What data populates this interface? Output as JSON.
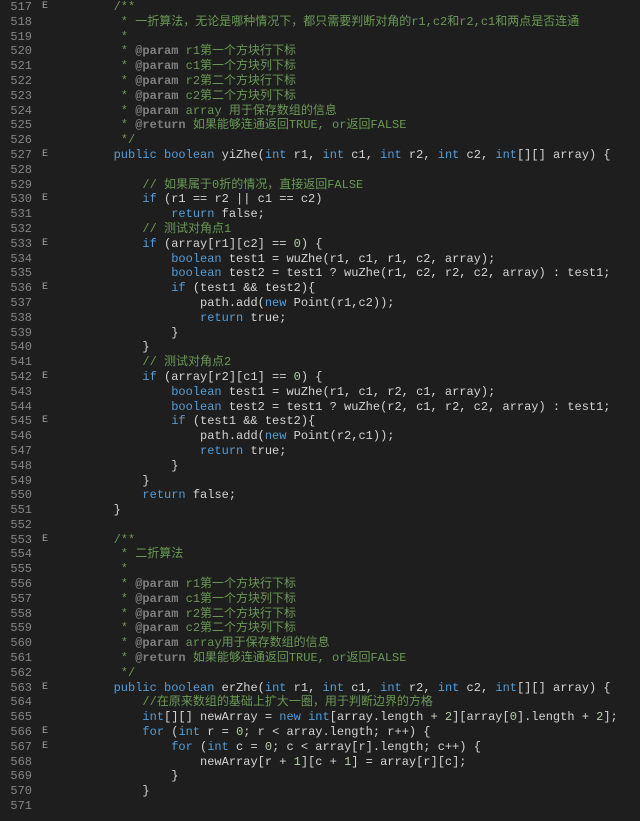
{
  "lines": [
    {
      "n": 517,
      "f": "E",
      "i": 2,
      "seg": [
        [
          "cmt",
          "/**"
        ]
      ]
    },
    {
      "n": 518,
      "f": "",
      "i": 2,
      "seg": [
        [
          "cmt",
          " * 一折算法，无论是哪种情况下，都只需要判断对角的r1,c2和r2,c1和两点是否连通"
        ]
      ]
    },
    {
      "n": 519,
      "f": "",
      "i": 2,
      "seg": [
        [
          "cmt",
          " *"
        ]
      ]
    },
    {
      "n": 520,
      "f": "",
      "i": 2,
      "seg": [
        [
          "cmt",
          " * "
        ],
        [
          "tag",
          "@param"
        ],
        [
          "cmt",
          " r1第一个方块行下标"
        ]
      ]
    },
    {
      "n": 521,
      "f": "",
      "i": 2,
      "seg": [
        [
          "cmt",
          " * "
        ],
        [
          "tag",
          "@param"
        ],
        [
          "cmt",
          " c1第一个方块列下标"
        ]
      ]
    },
    {
      "n": 522,
      "f": "",
      "i": 2,
      "seg": [
        [
          "cmt",
          " * "
        ],
        [
          "tag",
          "@param"
        ],
        [
          "cmt",
          " r2第二个方块行下标"
        ]
      ]
    },
    {
      "n": 523,
      "f": "",
      "i": 2,
      "seg": [
        [
          "cmt",
          " * "
        ],
        [
          "tag",
          "@param"
        ],
        [
          "cmt",
          " c2第二个方块列下标"
        ]
      ]
    },
    {
      "n": 524,
      "f": "",
      "i": 2,
      "seg": [
        [
          "cmt",
          " * "
        ],
        [
          "tag",
          "@param"
        ],
        [
          "cmt",
          " array 用于保存数组的信息"
        ]
      ]
    },
    {
      "n": 525,
      "f": "",
      "i": 2,
      "seg": [
        [
          "cmt",
          " * "
        ],
        [
          "tag",
          "@return"
        ],
        [
          "cmt",
          " 如果能够连通返回TRUE, or返回FALSE"
        ]
      ]
    },
    {
      "n": 526,
      "f": "",
      "i": 2,
      "seg": [
        [
          "cmt",
          " */"
        ]
      ]
    },
    {
      "n": 527,
      "f": "E",
      "i": 2,
      "seg": [
        [
          "kw",
          "public"
        ],
        [
          "pl",
          " "
        ],
        [
          "type",
          "boolean"
        ],
        [
          "pl",
          " "
        ],
        [
          "fn",
          "yiZhe"
        ],
        [
          "pl",
          "("
        ],
        [
          "type",
          "int"
        ],
        [
          "pl",
          " r1, "
        ],
        [
          "type",
          "int"
        ],
        [
          "pl",
          " c1, "
        ],
        [
          "type",
          "int"
        ],
        [
          "pl",
          " r2, "
        ],
        [
          "type",
          "int"
        ],
        [
          "pl",
          " c2, "
        ],
        [
          "type",
          "int"
        ],
        [
          "pl",
          "[][] array) {"
        ]
      ]
    },
    {
      "n": 528,
      "f": "",
      "i": 0,
      "seg": [
        [
          "pl",
          ""
        ]
      ]
    },
    {
      "n": 529,
      "f": "",
      "i": 3,
      "seg": [
        [
          "cmt",
          "// 如果属于0折的情况，直接返回FALSE"
        ]
      ]
    },
    {
      "n": 530,
      "f": "E",
      "i": 3,
      "seg": [
        [
          "kw",
          "if"
        ],
        [
          "pl",
          " (r1 == r2 || c1 == c2)"
        ]
      ]
    },
    {
      "n": 531,
      "f": "",
      "i": 4,
      "seg": [
        [
          "kw",
          "return"
        ],
        [
          "pl",
          " false;"
        ]
      ]
    },
    {
      "n": 532,
      "f": "",
      "i": 3,
      "seg": [
        [
          "cmt",
          "// 测试对角点1"
        ]
      ]
    },
    {
      "n": 533,
      "f": "E",
      "i": 3,
      "seg": [
        [
          "kw",
          "if"
        ],
        [
          "pl",
          " (array[r1][c2] == "
        ],
        [
          "num",
          "0"
        ],
        [
          "pl",
          ") {"
        ]
      ]
    },
    {
      "n": 534,
      "f": "",
      "i": 4,
      "seg": [
        [
          "type",
          "boolean"
        ],
        [
          "pl",
          " test1 = wuZhe(r1, c1, r1, c2, array);"
        ]
      ]
    },
    {
      "n": 535,
      "f": "",
      "i": 4,
      "seg": [
        [
          "type",
          "boolean"
        ],
        [
          "pl",
          " test2 = test1 ? wuZhe(r1, c2, r2, c2, array) : test1;"
        ]
      ]
    },
    {
      "n": 536,
      "f": "E",
      "i": 4,
      "seg": [
        [
          "kw",
          "if"
        ],
        [
          "pl",
          " (test1 && test2){"
        ]
      ]
    },
    {
      "n": 537,
      "f": "",
      "i": 5,
      "seg": [
        [
          "pl",
          "path.add("
        ],
        [
          "kw",
          "new"
        ],
        [
          "pl",
          " Point(r1,c2));"
        ]
      ]
    },
    {
      "n": 538,
      "f": "",
      "i": 5,
      "seg": [
        [
          "kw",
          "return"
        ],
        [
          "pl",
          " true;"
        ]
      ]
    },
    {
      "n": 539,
      "f": "",
      "i": 4,
      "seg": [
        [
          "pl",
          "}"
        ]
      ]
    },
    {
      "n": 540,
      "f": "",
      "i": 3,
      "seg": [
        [
          "pl",
          "}"
        ]
      ]
    },
    {
      "n": 541,
      "f": "",
      "i": 3,
      "seg": [
        [
          "cmt",
          "// 测试对角点2"
        ]
      ]
    },
    {
      "n": 542,
      "f": "E",
      "i": 3,
      "seg": [
        [
          "kw",
          "if"
        ],
        [
          "pl",
          " (array[r2][c1] == "
        ],
        [
          "num",
          "0"
        ],
        [
          "pl",
          ") {"
        ]
      ]
    },
    {
      "n": 543,
      "f": "",
      "i": 4,
      "seg": [
        [
          "type",
          "boolean"
        ],
        [
          "pl",
          " test1 = wuZhe(r1, c1, r2, c1, array);"
        ]
      ]
    },
    {
      "n": 544,
      "f": "",
      "i": 4,
      "seg": [
        [
          "type",
          "boolean"
        ],
        [
          "pl",
          " test2 = test1 ? wuZhe(r2, c1, r2, c2, array) : test1;"
        ]
      ]
    },
    {
      "n": 545,
      "f": "E",
      "i": 4,
      "seg": [
        [
          "kw",
          "if"
        ],
        [
          "pl",
          " (test1 && test2){"
        ]
      ]
    },
    {
      "n": 546,
      "f": "",
      "i": 5,
      "seg": [
        [
          "pl",
          "path.add("
        ],
        [
          "kw",
          "new"
        ],
        [
          "pl",
          " Point(r2,c1));"
        ]
      ]
    },
    {
      "n": 547,
      "f": "",
      "i": 5,
      "seg": [
        [
          "kw",
          "return"
        ],
        [
          "pl",
          " true;"
        ]
      ]
    },
    {
      "n": 548,
      "f": "",
      "i": 4,
      "seg": [
        [
          "pl",
          "}"
        ]
      ]
    },
    {
      "n": 549,
      "f": "",
      "i": 3,
      "seg": [
        [
          "pl",
          "}"
        ]
      ]
    },
    {
      "n": 550,
      "f": "",
      "i": 3,
      "seg": [
        [
          "kw",
          "return"
        ],
        [
          "pl",
          " false;"
        ]
      ]
    },
    {
      "n": 551,
      "f": "",
      "i": 2,
      "seg": [
        [
          "pl",
          "}"
        ]
      ]
    },
    {
      "n": 552,
      "f": "",
      "i": 0,
      "seg": [
        [
          "pl",
          ""
        ]
      ]
    },
    {
      "n": 553,
      "f": "E",
      "i": 2,
      "seg": [
        [
          "cmt",
          "/**"
        ]
      ]
    },
    {
      "n": 554,
      "f": "",
      "i": 2,
      "seg": [
        [
          "cmt",
          " * 二折算法"
        ]
      ]
    },
    {
      "n": 555,
      "f": "",
      "i": 2,
      "seg": [
        [
          "cmt",
          " *"
        ]
      ]
    },
    {
      "n": 556,
      "f": "",
      "i": 2,
      "seg": [
        [
          "cmt",
          " * "
        ],
        [
          "tag",
          "@param"
        ],
        [
          "cmt",
          " r1第一个方块行下标"
        ]
      ]
    },
    {
      "n": 557,
      "f": "",
      "i": 2,
      "seg": [
        [
          "cmt",
          " * "
        ],
        [
          "tag",
          "@param"
        ],
        [
          "cmt",
          " c1第一个方块列下标"
        ]
      ]
    },
    {
      "n": 558,
      "f": "",
      "i": 2,
      "seg": [
        [
          "cmt",
          " * "
        ],
        [
          "tag",
          "@param"
        ],
        [
          "cmt",
          " r2第二个方块行下标"
        ]
      ]
    },
    {
      "n": 559,
      "f": "",
      "i": 2,
      "seg": [
        [
          "cmt",
          " * "
        ],
        [
          "tag",
          "@param"
        ],
        [
          "cmt",
          " c2第二个方块列下标"
        ]
      ]
    },
    {
      "n": 560,
      "f": "",
      "i": 2,
      "seg": [
        [
          "cmt",
          " * "
        ],
        [
          "tag",
          "@param"
        ],
        [
          "cmt",
          " array用于保存数组的信息"
        ]
      ]
    },
    {
      "n": 561,
      "f": "",
      "i": 2,
      "seg": [
        [
          "cmt",
          " * "
        ],
        [
          "tag",
          "@return"
        ],
        [
          "cmt",
          " 如果能够连通返回TRUE, or返回FALSE"
        ]
      ]
    },
    {
      "n": 562,
      "f": "",
      "i": 2,
      "seg": [
        [
          "cmt",
          " */"
        ]
      ]
    },
    {
      "n": 563,
      "f": "E",
      "i": 2,
      "seg": [
        [
          "kw",
          "public"
        ],
        [
          "pl",
          " "
        ],
        [
          "type",
          "boolean"
        ],
        [
          "pl",
          " "
        ],
        [
          "fn",
          "erZhe"
        ],
        [
          "pl",
          "("
        ],
        [
          "type",
          "int"
        ],
        [
          "pl",
          " r1, "
        ],
        [
          "type",
          "int"
        ],
        [
          "pl",
          " c1, "
        ],
        [
          "type",
          "int"
        ],
        [
          "pl",
          " r2, "
        ],
        [
          "type",
          "int"
        ],
        [
          "pl",
          " c2, "
        ],
        [
          "type",
          "int"
        ],
        [
          "pl",
          "[][] array) {"
        ]
      ]
    },
    {
      "n": 564,
      "f": "",
      "i": 3,
      "seg": [
        [
          "cmt",
          "//在原来数组的基础上扩大一圈，用于判断边界的方格"
        ]
      ]
    },
    {
      "n": 565,
      "f": "",
      "i": 3,
      "seg": [
        [
          "type",
          "int"
        ],
        [
          "pl",
          "[][] newArray = "
        ],
        [
          "kw",
          "new"
        ],
        [
          "pl",
          " "
        ],
        [
          "type",
          "int"
        ],
        [
          "pl",
          "[array.length + "
        ],
        [
          "num",
          "2"
        ],
        [
          "pl",
          "][array["
        ],
        [
          "num",
          "0"
        ],
        [
          "pl",
          "].length + "
        ],
        [
          "num",
          "2"
        ],
        [
          "pl",
          "];"
        ]
      ]
    },
    {
      "n": 566,
      "f": "E",
      "i": 3,
      "seg": [
        [
          "kw",
          "for"
        ],
        [
          "pl",
          " ("
        ],
        [
          "type",
          "int"
        ],
        [
          "pl",
          " r = "
        ],
        [
          "num",
          "0"
        ],
        [
          "pl",
          "; r < array.length; r++) {"
        ]
      ]
    },
    {
      "n": 567,
      "f": "E",
      "i": 4,
      "seg": [
        [
          "kw",
          "for"
        ],
        [
          "pl",
          " ("
        ],
        [
          "type",
          "int"
        ],
        [
          "pl",
          " c = "
        ],
        [
          "num",
          "0"
        ],
        [
          "pl",
          "; c < array[r].length; c++) {"
        ]
      ]
    },
    {
      "n": 568,
      "f": "",
      "i": 5,
      "seg": [
        [
          "pl",
          "newArray[r + "
        ],
        [
          "num",
          "1"
        ],
        [
          "pl",
          "][c + "
        ],
        [
          "num",
          "1"
        ],
        [
          "pl",
          "] = array[r][c];"
        ]
      ]
    },
    {
      "n": 569,
      "f": "",
      "i": 4,
      "seg": [
        [
          "pl",
          "}"
        ]
      ]
    },
    {
      "n": 570,
      "f": "",
      "i": 3,
      "seg": [
        [
          "pl",
          "}"
        ]
      ]
    },
    {
      "n": 571,
      "f": "",
      "i": 0,
      "seg": [
        [
          "pl",
          ""
        ]
      ]
    }
  ]
}
